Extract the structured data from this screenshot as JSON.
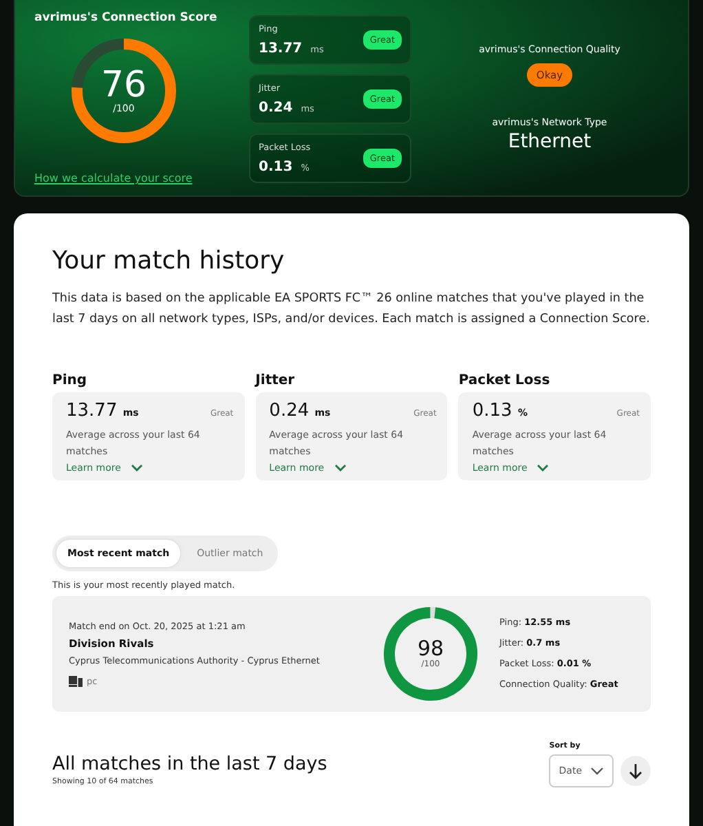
{
  "score_card": {
    "title": "avrimus's Connection Score",
    "score": "76",
    "out_of": "/100",
    "level": 0.76,
    "link": "How we calculate your score",
    "metrics": [
      {
        "label": "Ping",
        "value": "13.77",
        "unit": "ms",
        "badge": "Great"
      },
      {
        "label": "Jitter",
        "value": "0.24",
        "unit": "ms",
        "badge": "Great"
      },
      {
        "label": "Packet Loss",
        "value": "0.13",
        "unit": "%",
        "badge": "Great"
      }
    ],
    "quality_label": "avrimus's Connection Quality",
    "quality": "Okay",
    "network_label": "avrimus's Network Type",
    "network": "Ethernet"
  },
  "history": {
    "title": "Your match history",
    "description": "This data is based on the applicable EA SPORTS FC™ 26 online matches that you've played in the last 7 days on all network types, ISPs, and/or devices. Each match is assigned a Connection Score.",
    "metrics": [
      {
        "label": "Ping",
        "value": "13.77",
        "unit": "ms",
        "rating": "Great",
        "note": "Average across your last 64 matches",
        "link": "Learn more"
      },
      {
        "label": "Jitter",
        "value": "0.24",
        "unit": "ms",
        "rating": "Great",
        "note": "Average across your last 64 matches",
        "link": "Learn more"
      },
      {
        "label": "Packet Loss",
        "value": "0.13",
        "unit": "%",
        "rating": "Great",
        "note": "Average across your last 64 matches",
        "link": "Learn more"
      }
    ],
    "tabs": [
      {
        "label": "Most recent match",
        "selected": true
      },
      {
        "label": "Outlier match",
        "selected": false
      }
    ],
    "tab_note": "This is your most recently played match.",
    "match": {
      "ended": "Match end on Oct. 20, 2025 at 1:21 am",
      "mode": "Division Rivals",
      "provider": "Cyprus Telecommunications Authority - Cyprus Ethernet",
      "platform": "pc",
      "score": "98",
      "out_of": "/100",
      "level": 0.98,
      "stats": [
        {
          "label": "Ping:",
          "value": "12.55 ms"
        },
        {
          "label": "Jitter:",
          "value": "0.7 ms"
        },
        {
          "label": "Packet Loss:",
          "value": "0.01 %"
        },
        {
          "label": "Connection Quality:",
          "value": "Great"
        }
      ]
    }
  },
  "all_matches": {
    "title": "All matches in the last 7 days",
    "count": "Showing 10 of 64 matches",
    "sort_label": "Sort by",
    "sort_value": "Date"
  }
}
